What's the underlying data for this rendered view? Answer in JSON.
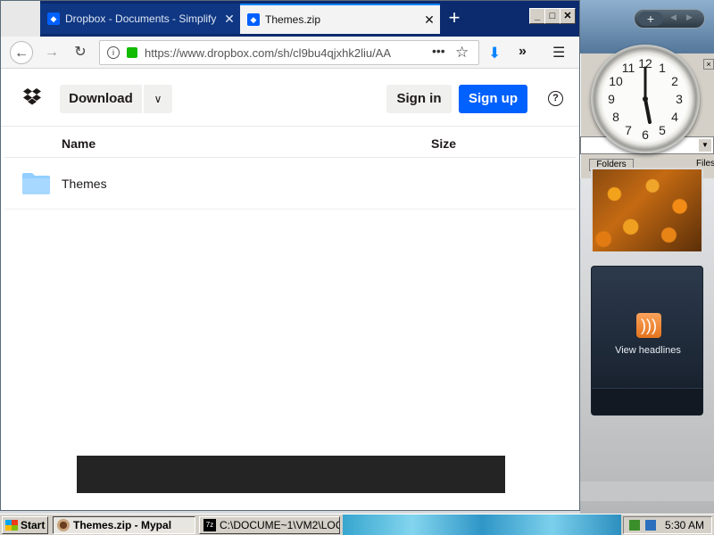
{
  "browser": {
    "tabs": [
      {
        "title": "Dropbox - Documents - Simplify yo",
        "active": false
      },
      {
        "title": "Themes.zip",
        "active": true
      }
    ],
    "new_tab_symbol": "+",
    "window_buttons": {
      "minimize": "_",
      "maximize": "□",
      "close": "✕"
    },
    "url": "https://www.dropbox.com/sh/cl9bu4qjxhk2liu/AA",
    "url_more": "•••"
  },
  "page": {
    "download_label": "Download",
    "signin_label": "Sign in",
    "signup_label": "Sign up",
    "help_symbol": "?",
    "table": {
      "columns": [
        "Name",
        "Size"
      ],
      "rows": [
        {
          "name": "Themes",
          "size": "",
          "type": "folder"
        }
      ]
    },
    "accent": "#0061fe"
  },
  "sidebar": {
    "feed_label": "View headlines",
    "folders_tab": "Folders",
    "files_tab": "Files",
    "clock_time": "5:30"
  },
  "taskbar": {
    "start_label": "Start",
    "tasks": [
      {
        "label": "Themes.zip - Mypal",
        "active": true
      },
      {
        "label": "C:\\DOCUME~1\\VM2\\LOC...",
        "active": false
      }
    ],
    "time": "5:30 AM"
  }
}
